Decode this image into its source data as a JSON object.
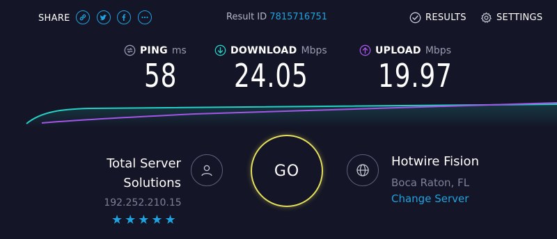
{
  "top": {
    "share_label": "SHARE",
    "share_icons": [
      "link-icon",
      "twitter-icon",
      "facebook-icon",
      "more-icon"
    ],
    "result_id_label": "Result ID",
    "result_id_value": "7815716751",
    "results_label": "RESULTS",
    "settings_label": "SETTINGS"
  },
  "metrics": {
    "ping": {
      "label": "PING",
      "unit": "ms",
      "value": "58",
      "icon": "ping-icon",
      "color": "#9a9cb0"
    },
    "download": {
      "label": "DOWNLOAD",
      "unit": "Mbps",
      "value": "24.05",
      "icon": "download-icon",
      "color": "#25d2c6"
    },
    "upload": {
      "label": "UPLOAD",
      "unit": "Mbps",
      "value": "19.97",
      "icon": "upload-icon",
      "color": "#a456e8"
    }
  },
  "host": {
    "name_line1": "Total Server",
    "name_line2": "Solutions",
    "ip": "192.252.210.15",
    "stars": "★★★★★",
    "rating": 5
  },
  "go_label": "GO",
  "isp": {
    "name": "Hotwire Fision",
    "location": "Boca Raton, FL",
    "change_server_label": "Change Server"
  },
  "colors": {
    "background": "#141526",
    "accent_blue": "#1fa3e0",
    "download": "#25d2c6",
    "upload": "#a456e8",
    "go_ring": "#e6e05c"
  }
}
